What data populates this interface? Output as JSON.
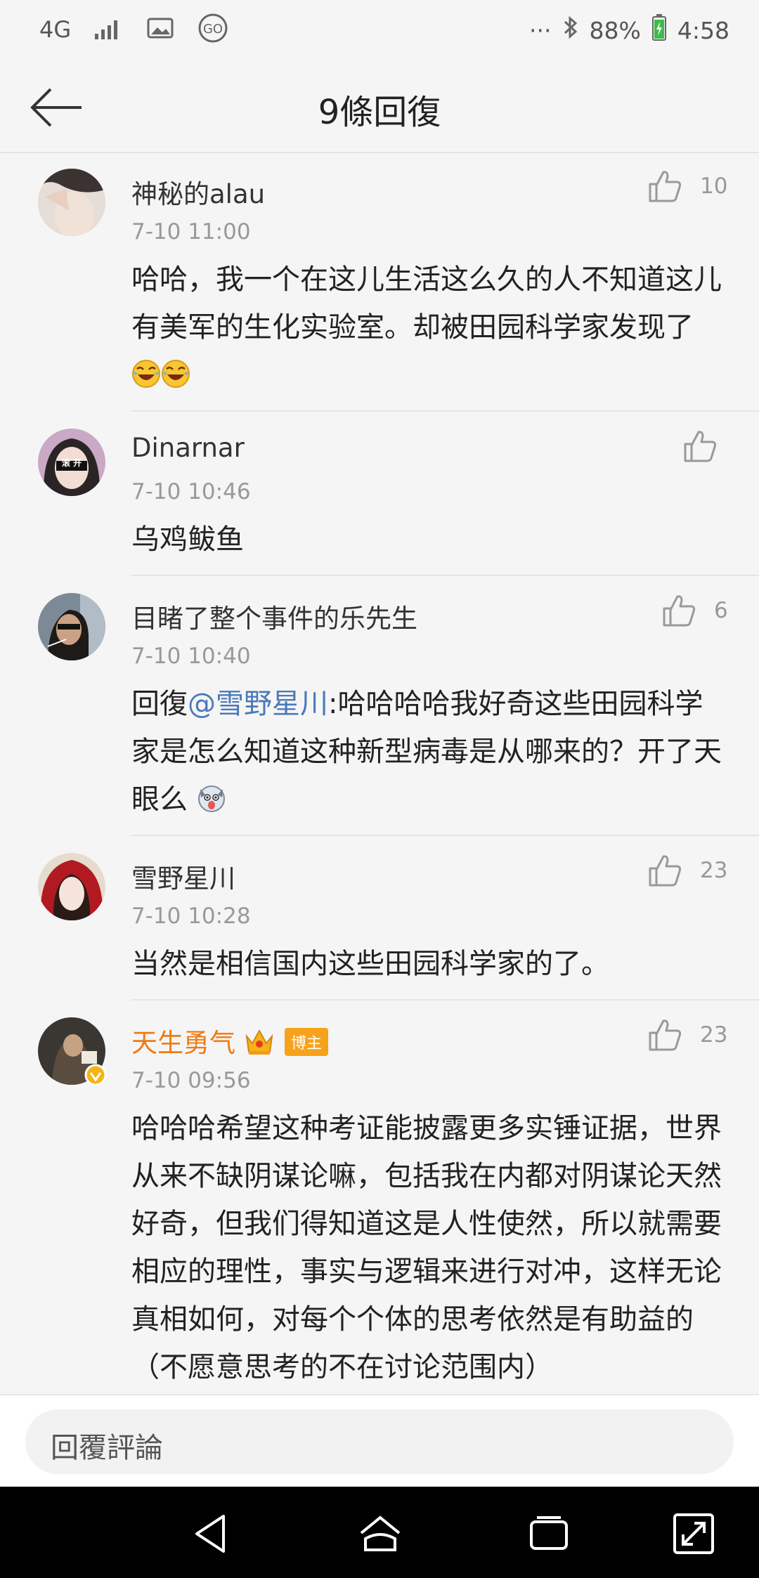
{
  "status_bar": {
    "network": "4G",
    "battery": "88%",
    "time": "4:58",
    "more": "···"
  },
  "header": {
    "title": "9條回復"
  },
  "comments": [
    {
      "name": "神秘的alau",
      "time": "7-10 11:00",
      "likes": "10",
      "content": "哈哈，我一个在这儿生活这么久的人不知道这儿有美军的生化实验室。却被田园科学家发现了"
    },
    {
      "name": "Dinarnar",
      "time": "7-10 10:46",
      "likes": "",
      "content": "乌鸡鲅鱼",
      "avatar_text": "滚 开"
    },
    {
      "name": "目睹了整个事件的乐先生",
      "time": "7-10 10:40",
      "likes": "6",
      "reply_prefix": "回復",
      "mention": "@雪野星川",
      "content": ":哈哈哈哈我好奇这些田园科学家是怎么知道这种新型病毒是从哪来的？开了天眼么"
    },
    {
      "name": "雪野星川",
      "time": "7-10 10:28",
      "likes": "23",
      "content": "当然是相信国内这些田园科学家的了。"
    },
    {
      "name": "天生勇气",
      "badge": "博主",
      "time": "7-10 09:56",
      "likes": "23",
      "content": "哈哈哈希望这种考证能披露更多实锤证据，世界从来不缺阴谋论嘛，包括我在内都对阴谋论天然好奇，但我们得知道这是人性使然，所以就需要相应的理性，事实与逻辑来进行对冲，这样无论真相如何，对每个个体的思考依然是有助益的（不愿意思考的不在讨论范围内）"
    }
  ],
  "reply_bar": {
    "placeholder": "回覆評論"
  },
  "colors": {
    "vip_name": "#f07a13",
    "mention": "#4a7ab8",
    "badge": "#f7a21c"
  }
}
